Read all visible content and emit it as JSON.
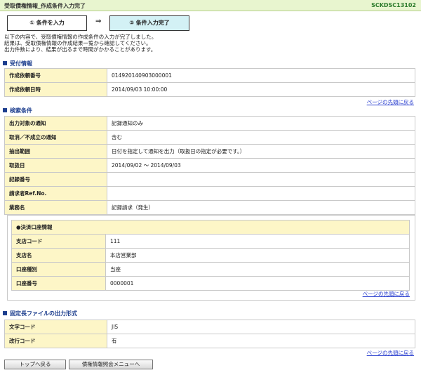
{
  "header": {
    "title": "受取債権情報_作成条件入力完了",
    "screen_id": "SCKDSC13102"
  },
  "steps": {
    "step1": "① 条件を入力",
    "arrow": "⇒",
    "step2": "② 条件入力完了"
  },
  "intro": [
    "以下の内容で、受取債権情報の作成条件の入力が完了しました。",
    "結果は、受取債権情報の作成結果一覧から確認してください。",
    "出力件数により、結果が出るまで時間がかかることがあります。"
  ],
  "receipt": {
    "title": "受付情報",
    "rows": [
      {
        "label": "作成依頼番号",
        "value": "014920140903000001"
      },
      {
        "label": "作成依頼日時",
        "value": "2014/09/03 10:00:00"
      }
    ]
  },
  "search": {
    "title": "検索条件",
    "rows": [
      {
        "label": "出力対象の通知",
        "value": "記録通知のみ"
      },
      {
        "label": "取消／不成立の通知",
        "value": "含む"
      },
      {
        "label": "抽出範囲",
        "value": "日付を指定して通知を出力（取扱日の指定が必要です。）"
      },
      {
        "label": "取扱日",
        "value": "2014/09/02 ～ 2014/09/03"
      },
      {
        "label": "記録番号",
        "value": ""
      },
      {
        "label": "請求者Ref.No.",
        "value": ""
      },
      {
        "label": "業務名",
        "value": "記録請求（発生）"
      }
    ],
    "settlement": {
      "title": "●決済口座情報",
      "rows": [
        {
          "label": "支店コード",
          "value": "111"
        },
        {
          "label": "支店名",
          "value": "本店営業部"
        },
        {
          "label": "口座種別",
          "value": "当座"
        },
        {
          "label": "口座番号",
          "value": "0000001"
        }
      ]
    }
  },
  "format": {
    "title": "固定長ファイルの出力形式",
    "rows": [
      {
        "label": "文字コード",
        "value": "JIS"
      },
      {
        "label": "改行コード",
        "value": "有"
      }
    ]
  },
  "links": {
    "page_top": "ページの先頭に戻る"
  },
  "buttons": {
    "back_top": "トップへ戻る",
    "menu": "債権情報照会メニューへ"
  }
}
